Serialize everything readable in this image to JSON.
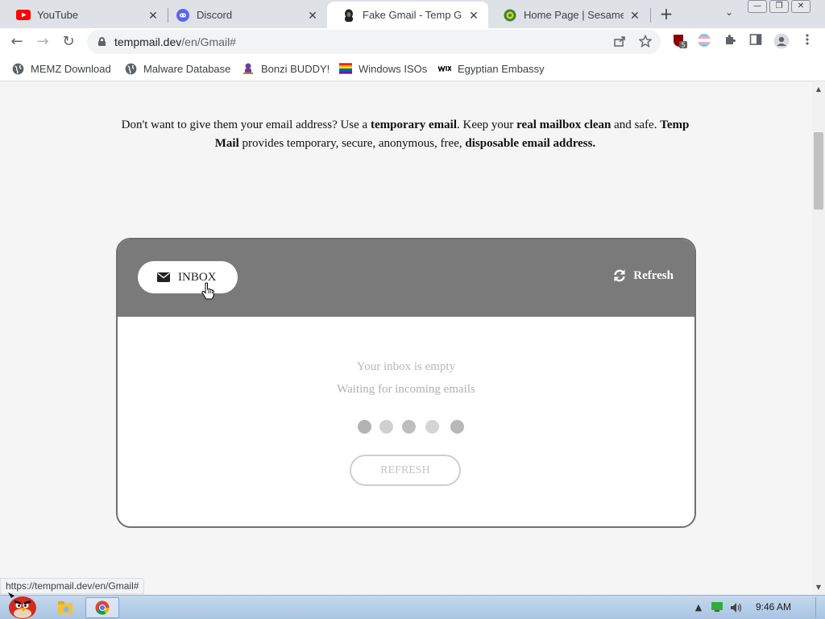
{
  "browser": {
    "tabs": [
      {
        "label": "YouTube",
        "icon": "youtube-icon",
        "close": "✕"
      },
      {
        "label": "Discord",
        "icon": "discord-icon",
        "close": "✕"
      },
      {
        "label": "Fake Gmail - Temp GMail",
        "icon": "hacker-icon",
        "close": "✕",
        "active": true
      },
      {
        "label": "Home Page | Sesame Street",
        "icon": "sesame-icon",
        "close": "✕"
      }
    ],
    "new_tab": "+",
    "tab_search": "⌄",
    "window_controls": {
      "minimize": "—",
      "restore": "❐",
      "close": "✕"
    }
  },
  "toolbar": {
    "back": "←",
    "forward": "→",
    "reload": "↻",
    "url_host": "tempmail.dev",
    "url_path": "/en/Gmail#",
    "extension_badge": "5"
  },
  "bookmarks": [
    {
      "label": "MEMZ Download",
      "icon": "globe-icon"
    },
    {
      "label": "Malware Database",
      "icon": "globe-icon"
    },
    {
      "label": "Bonzi BUDDY!",
      "icon": "bonzi-icon"
    },
    {
      "label": "Windows ISOs",
      "icon": "rainbow-flag-icon"
    },
    {
      "label": "Egyptian Embassy",
      "icon": "wix-icon"
    }
  ],
  "page": {
    "intro_1": "Don't want to give them your email address? Use a ",
    "intro_b1": "temporary email",
    "intro_2": ". Keep your ",
    "intro_b2": "real mailbox clean",
    "intro_3": " and safe. ",
    "intro_b3": "Temp Mail",
    "intro_4": " provides temporary, secure, anonymous, free, ",
    "intro_b4": "disposable email address.",
    "inbox_label": "INBOX",
    "refresh_link": "Refresh",
    "empty_title": "Your inbox is empty",
    "empty_sub": "Waiting for incoming emails",
    "refresh_button": "REFRESH",
    "loading_dot_colors": [
      "#b3b3b3",
      "#d0d0d0",
      "#bdbdbd",
      "#d5d5d5",
      "#b8b8b8"
    ]
  },
  "status_url": "https://tempmail.dev/en/Gmail#",
  "taskbar": {
    "clock": "9:46 AM"
  },
  "colors": {
    "card_header": "#7a7a7a",
    "tab_bar": "#dee1e6",
    "taskbar": "#b7cfe9"
  }
}
